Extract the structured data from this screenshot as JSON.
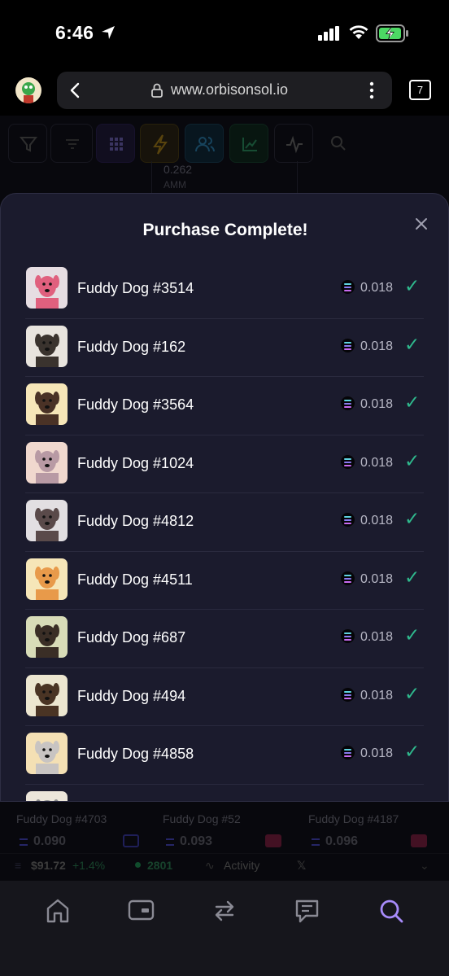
{
  "status_bar": {
    "time": "6:46"
  },
  "browser": {
    "url": "www.orbisonsol.io",
    "tab_count": "7"
  },
  "background": {
    "card_value": "0.262",
    "card_label": "AMM",
    "bottom_cards": [
      {
        "name": "Fuddy Dog #4703",
        "price": "0.090"
      },
      {
        "name": "Fuddy Dog #52",
        "price": "0.093"
      },
      {
        "name": "Fuddy Dog #4187",
        "price": "0.096"
      }
    ],
    "ticker": {
      "sol_price": "$91.72",
      "sol_change": "+1.4%",
      "online": "2801",
      "activity": "Activity"
    }
  },
  "modal": {
    "title": "Purchase Complete!",
    "items": [
      {
        "name": "Fuddy Dog #3514",
        "price": "0.018",
        "thumb_bg": "#e6dde2",
        "dog_color": "#e0607e"
      },
      {
        "name": "Fuddy Dog #162",
        "price": "0.018",
        "thumb_bg": "#e8e4de",
        "dog_color": "#3a332e"
      },
      {
        "name": "Fuddy Dog #3564",
        "price": "0.018",
        "thumb_bg": "#f6e6b8",
        "dog_color": "#4a3226"
      },
      {
        "name": "Fuddy Dog #1024",
        "price": "0.018",
        "thumb_bg": "#f0d8ce",
        "dog_color": "#b89aa4"
      },
      {
        "name": "Fuddy Dog #4812",
        "price": "0.018",
        "thumb_bg": "#e2dfe2",
        "dog_color": "#5a4a4a"
      },
      {
        "name": "Fuddy Dog #4511",
        "price": "0.018",
        "thumb_bg": "#f6e6b8",
        "dog_color": "#e89a4a"
      },
      {
        "name": "Fuddy Dog #687",
        "price": "0.018",
        "thumb_bg": "#d8dcb8",
        "dog_color": "#3a2e26"
      },
      {
        "name": "Fuddy Dog #494",
        "price": "0.018",
        "thumb_bg": "#ece6d0",
        "dog_color": "#4a3424"
      },
      {
        "name": "Fuddy Dog #4858",
        "price": "0.018",
        "thumb_bg": "#f4e0b4",
        "dog_color": "#c8c4c2"
      },
      {
        "name": "",
        "price": "",
        "thumb_bg": "#ece6da",
        "dog_color": "#8a8a8a"
      }
    ]
  },
  "colors": {
    "accent_green": "#2fb98d",
    "accent_purple": "#a78bfa",
    "modal_bg": "#1b1b2d"
  }
}
